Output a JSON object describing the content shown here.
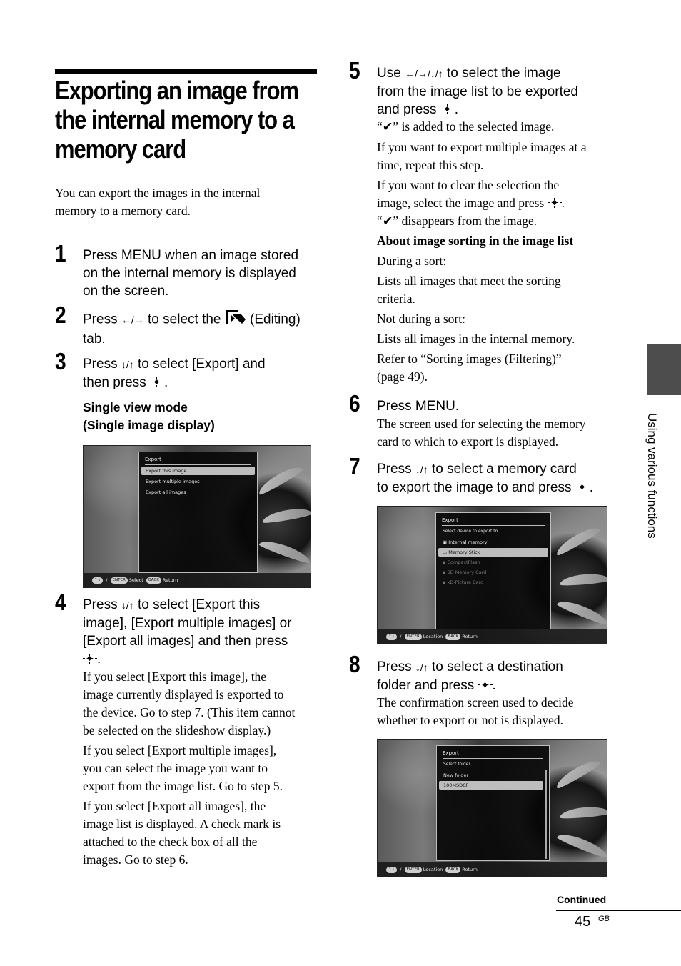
{
  "page": {
    "title_lines": [
      "Exporting an image from",
      "the internal memory to a",
      "memory card"
    ],
    "intro": [
      "You can export the images in the internal",
      "memory to a memory card."
    ],
    "side_tab_label": "Using various functions",
    "continued": "Continued",
    "page_number": "45",
    "page_suffix": "GB"
  },
  "steps": [
    {
      "num": "1",
      "lines": [
        "Press MENU when an image stored",
        "on the internal memory is displayed",
        "on the screen."
      ]
    },
    {
      "num": "2",
      "pre": "Press",
      "arrows": "←/→",
      "mid": "to select the",
      "icon": "editing-tab-icon",
      "post": "(Editing)",
      "line2": "tab."
    },
    {
      "num": "3",
      "pre": "Press",
      "arrows": "↓/↑",
      "post": "to select [Export] and",
      "line2": "then press",
      "sub_heading": [
        "Single view mode",
        "(Single image display)"
      ]
    },
    {
      "num": "4",
      "pre": "Press",
      "arrows": "↓/↑",
      "post": "to select [Export this",
      "lines": [
        "image], [Export multiple images] or",
        "[Export all images] and then press"
      ],
      "body": [
        [
          "If you select [Export this image], the",
          "image currently displayed is exported to",
          "the device. Go to step 7. (This item cannot",
          "be selected on the slideshow display.)"
        ],
        [
          "If you select [Export multiple images],",
          "you can select the image you want to",
          "export from the image list. Go to step 5."
        ],
        [
          "If you select [Export all images], the",
          "image list is displayed. A check mark is",
          "attached to the check box of all the",
          "images. Go to step 6."
        ]
      ]
    },
    {
      "num": "5",
      "pre": "Use",
      "arrows": "←/→/↓/↑",
      "post": "to select the image",
      "lines": [
        "from the image list to be exported"
      ],
      "line3": "and press",
      "check_added": "“✔” is added to the selected image.",
      "body1": [
        "If you want to export multiple images at a",
        "time, repeat this step."
      ],
      "body2a": "If you want to clear the selection the",
      "body2b": "image, select the image and press",
      "check_removed": "“✔” disappears from the image.",
      "about_heading": "About image sorting in the image list",
      "sort": [
        "During a sort:",
        "Lists all images that meet the sorting",
        "criteria.",
        "Not during a sort:",
        "Lists all images in the internal memory.",
        "Refer to “Sorting images (Filtering)”",
        "(page 49)."
      ]
    },
    {
      "num": "6",
      "line": "Press MENU.",
      "body": [
        "The screen used for selecting the memory",
        "card to which to export is displayed."
      ]
    },
    {
      "num": "7",
      "pre": "Press",
      "arrows": "↓/↑",
      "post": "to select a memory card",
      "line2": "to export the image to and press"
    },
    {
      "num": "8",
      "pre": "Press",
      "arrows": "↓/↑",
      "post": "to select a destination",
      "line2": "folder and press",
      "body": [
        "The confirmation screen used to decide",
        "whether to export or not is displayed."
      ]
    }
  ],
  "screens": {
    "export_menu": {
      "title": "Export",
      "items": [
        "Export this image",
        "Export multiple images",
        "Export all images"
      ],
      "selected_index": 0,
      "status": {
        "nav": "↑↓",
        "enter": "ENTER",
        "enter_label": "Select",
        "back": "BACK",
        "back_label": "Return"
      }
    },
    "select_device": {
      "title": "Export",
      "prompt": "Select device to export to.",
      "items": [
        "Internal memory",
        "Memory Stick",
        "CompactFlash",
        "SD Memory Card",
        "xD-Picture Card"
      ],
      "selected_index": 1,
      "status": {
        "nav": "↑↓",
        "enter": "ENTER",
        "enter_label": "Location",
        "back": "BACK",
        "back_label": "Return"
      }
    },
    "select_folder": {
      "title": "Export",
      "prompt": "Select folder.",
      "items": [
        "New folder",
        "100MSDCF"
      ],
      "selected_index": 1,
      "status": {
        "nav": "↑↓",
        "enter": "ENTER",
        "enter_label": "Location",
        "back": "BACK",
        "back_label": "Return"
      }
    }
  }
}
